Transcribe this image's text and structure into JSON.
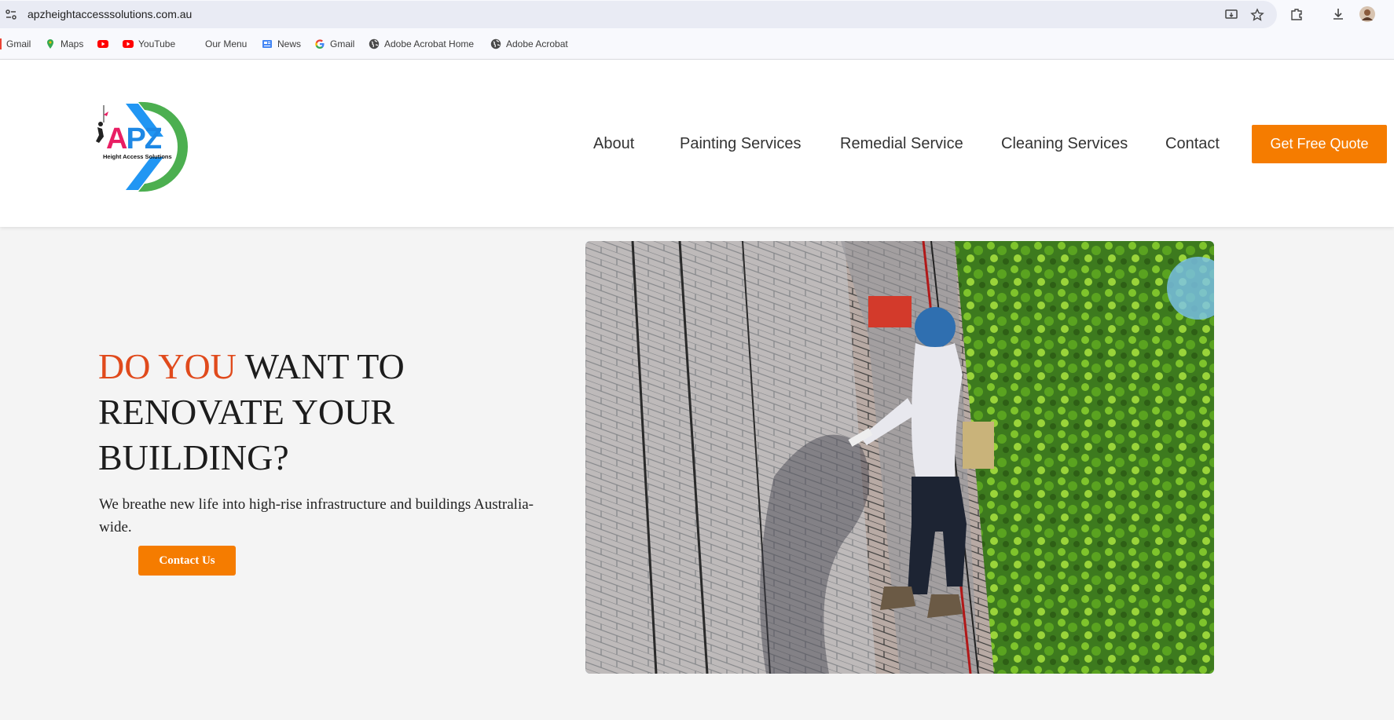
{
  "browser": {
    "url": "apzheightaccesssolutions.com.au",
    "bookmarks": [
      {
        "label": "Gmail",
        "icon": "gmail-icon"
      },
      {
        "label": "Maps",
        "icon": "maps-icon"
      },
      {
        "label": "",
        "icon": "youtube-icon"
      },
      {
        "label": "YouTube",
        "icon": "youtube-icon"
      },
      {
        "label": "Our Menu",
        "icon": ""
      },
      {
        "label": "News",
        "icon": "news-icon"
      },
      {
        "label": "Gmail",
        "icon": "google-icon"
      },
      {
        "label": "Adobe Acrobat Home",
        "icon": "globe-icon"
      },
      {
        "label": "Adobe Acrobat",
        "icon": "globe-icon"
      }
    ]
  },
  "site": {
    "logo_text": "APZ",
    "logo_tagline": "Height Access Solutions",
    "nav": [
      {
        "label": "About"
      },
      {
        "label": "Painting Services"
      },
      {
        "label": "Remedial Service"
      },
      {
        "label": "Cleaning Services"
      },
      {
        "label": "Contact"
      }
    ],
    "cta_label": "Get Free Quote",
    "accent_color": "#f57c00"
  },
  "hero": {
    "title_highlight": "DO YOU",
    "title_rest": " WANT TO RENOVATE YOUR BUILDING?",
    "subtitle": "We breathe new life into high-rise infrastructure and buildings Australia-wide.",
    "button_label": "Contact Us",
    "highlight_color": "#e04a1c"
  }
}
